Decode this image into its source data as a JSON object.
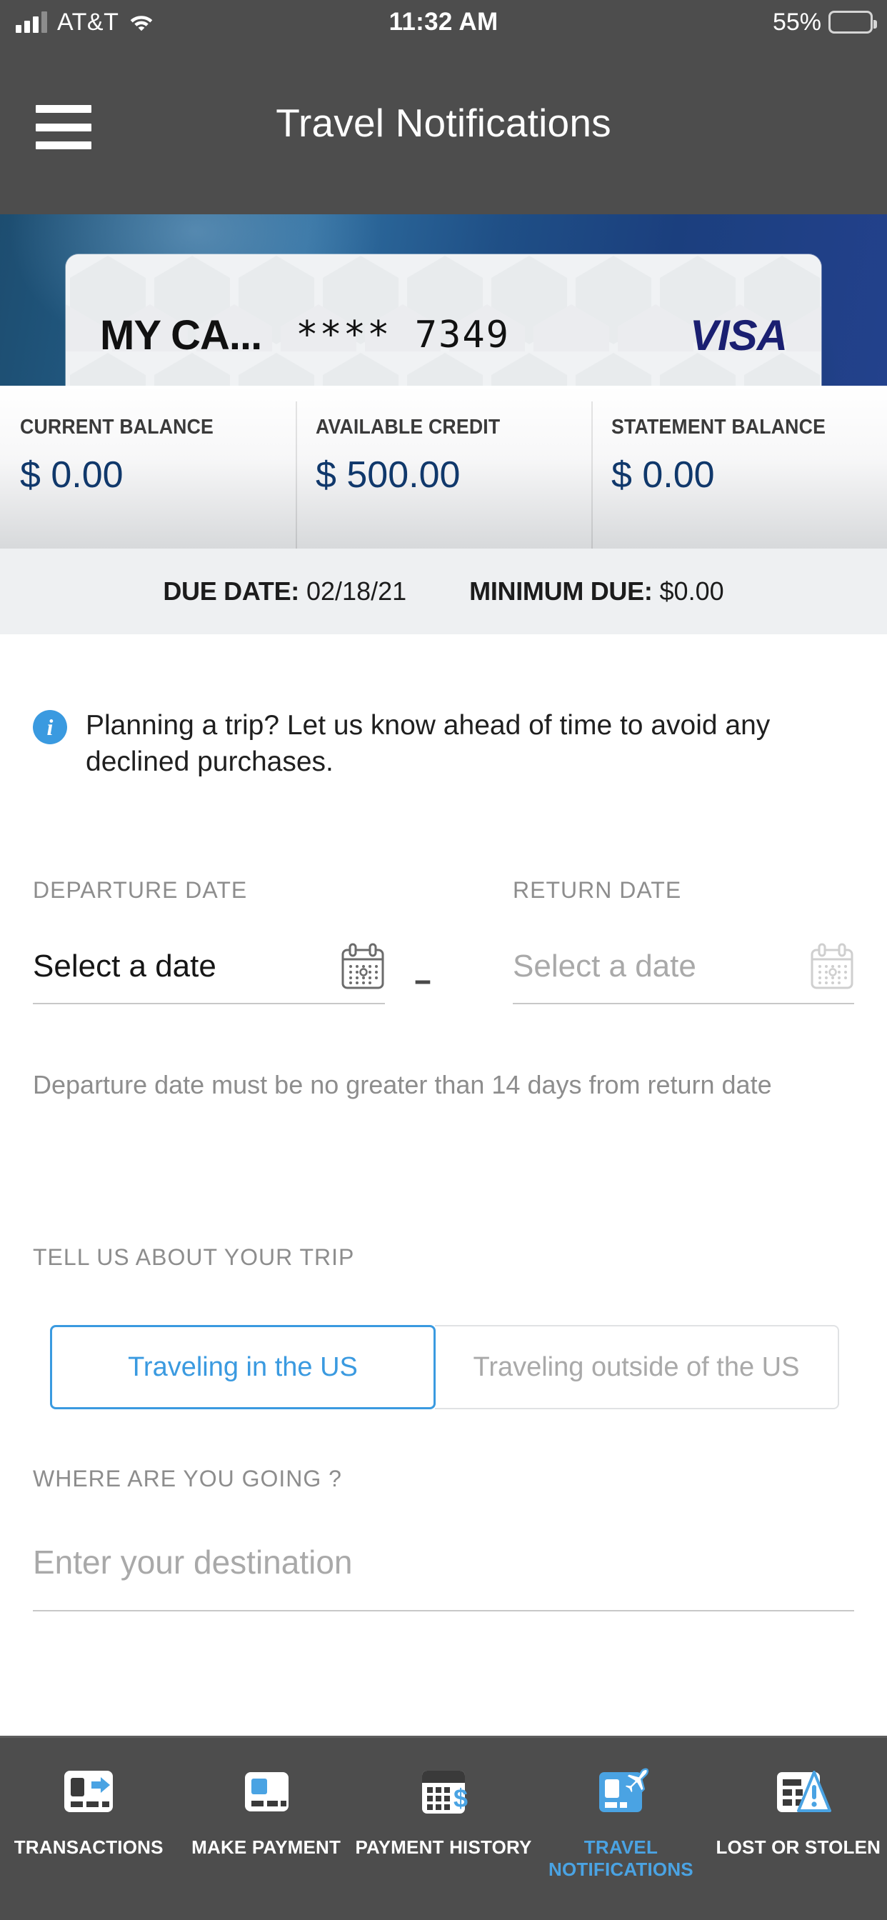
{
  "status_bar": {
    "carrier": "AT&T",
    "time": "11:32 AM",
    "battery_percent": "55%",
    "signal_icon": "cellular-signal-icon",
    "wifi_icon": "wifi-icon",
    "battery_icon": "battery-icon",
    "battery_level": 55
  },
  "navbar": {
    "title": "Travel Notifications",
    "menu_icon": "hamburger-menu-icon"
  },
  "card": {
    "nickname": "MY CA...",
    "number_masked": "**** 7349",
    "brand": "VISA",
    "brand_color": "#1a1f71"
  },
  "balances": [
    {
      "label": "CURRENT BALANCE",
      "value": "$ 0.00"
    },
    {
      "label": "AVAILABLE CREDIT",
      "value": "$ 500.00"
    },
    {
      "label": "STATEMENT BALANCE",
      "value": "$ 0.00"
    }
  ],
  "due": {
    "due_date_label": "DUE DATE:",
    "due_date_value": "02/18/21",
    "minimum_due_label": "MINIMUM DUE:",
    "minimum_due_value": "$0.00"
  },
  "info_note": {
    "icon": "info-circle-icon",
    "text": "Planning a trip? Let us know ahead of time to avoid any declined purchases."
  },
  "departure": {
    "label": "DEPARTURE DATE",
    "placeholder": "Select a date",
    "calendar_icon": "calendar-icon"
  },
  "return": {
    "label": "RETURN DATE",
    "placeholder": "Select a date",
    "calendar_icon": "calendar-icon"
  },
  "date_separator": "--",
  "date_help": "Departure date must be no greater than 14 days from return date",
  "trip_section": {
    "label": "TELL US ABOUT YOUR TRIP",
    "options": [
      {
        "label": "Traveling in the US",
        "selected": true
      },
      {
        "label": "Traveling outside of the US",
        "selected": false
      }
    ],
    "selected_color": "#3a9ae0"
  },
  "destination": {
    "label": "WHERE ARE YOU GOING ?",
    "placeholder": "Enter your destination",
    "value": ""
  },
  "tabbar": {
    "active_color": "#4aa3e3",
    "items": [
      {
        "label": "TRANSACTIONS",
        "icon": "card-arrow-icon",
        "active": false
      },
      {
        "label": "MAKE PAYMENT",
        "icon": "card-payment-icon",
        "active": false
      },
      {
        "label": "PAYMENT\nHISTORY",
        "icon": "calendar-dollar-icon",
        "active": false
      },
      {
        "label": "TRAVEL\nNOTIFICATIONS",
        "icon": "card-airplane-icon",
        "active": true
      },
      {
        "label": "LOST OR\nSTOLEN",
        "icon": "card-warning-icon",
        "active": false
      }
    ]
  }
}
